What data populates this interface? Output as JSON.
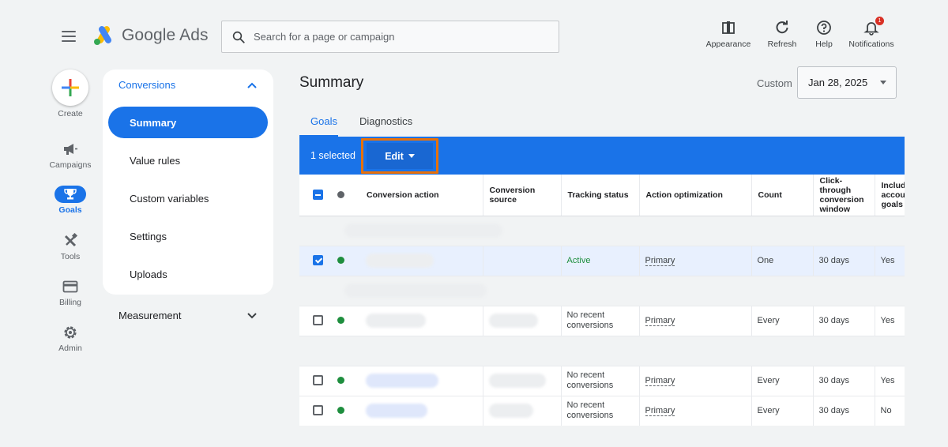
{
  "header": {
    "brand": "Google Ads",
    "search_placeholder": "Search for a page or campaign",
    "actions": [
      {
        "label": "Appearance",
        "icon": "appearance-icon"
      },
      {
        "label": "Refresh",
        "icon": "refresh-icon"
      },
      {
        "label": "Help",
        "icon": "help-icon"
      },
      {
        "label": "Notifications",
        "icon": "bell-icon",
        "badge": "1"
      }
    ]
  },
  "rail": {
    "create": "Create",
    "items": [
      {
        "label": "Campaigns",
        "icon": "megaphone-icon"
      },
      {
        "label": "Goals",
        "icon": "trophy-icon",
        "active": true
      },
      {
        "label": "Tools",
        "icon": "tools-icon"
      },
      {
        "label": "Billing",
        "icon": "credit-card-icon"
      },
      {
        "label": "Admin",
        "icon": "gear-icon"
      }
    ]
  },
  "subnav": {
    "section": "Conversions",
    "items": [
      {
        "label": "Summary",
        "active": true
      },
      {
        "label": "Value rules"
      },
      {
        "label": "Custom variables"
      },
      {
        "label": "Settings"
      },
      {
        "label": "Uploads"
      }
    ],
    "measurement": "Measurement"
  },
  "main": {
    "title": "Summary",
    "date_label": "Custom",
    "date_value": "Jan 28, 2025",
    "tabs": [
      "Goals",
      "Diagnostics"
    ],
    "selection_text": "1 selected",
    "edit_label": "Edit"
  },
  "table": {
    "columns": [
      "Conversion action",
      "Conversion source",
      "Tracking status",
      "Action optimization",
      "Count",
      "Click-through conversion window",
      "Include in account-level goals"
    ],
    "columns_display": [
      "Conversion action",
      "Conversion source",
      "Tracking status",
      "Action optimization",
      "Count",
      "Click-through conversion window",
      "Include accoun goals"
    ],
    "rows": [
      {
        "checked": true,
        "status": "Active",
        "optimization": "Primary",
        "count": "One",
        "window": "30 days",
        "include": "Yes"
      },
      {
        "checked": false,
        "status": "No recent conversions",
        "optimization": "Primary",
        "count": "Every",
        "window": "30 days",
        "include": "Yes"
      },
      {
        "checked": false,
        "status": "No recent conversions",
        "optimization": "Primary",
        "count": "Every",
        "window": "30 days",
        "include": "Yes"
      },
      {
        "checked": false,
        "status": "No recent conversions",
        "optimization": "Primary",
        "count": "Every",
        "window": "30 days",
        "include": "No"
      }
    ]
  },
  "colors": {
    "accent": "#1a73e8",
    "highlight": "#e8710a",
    "status_green": "#1e8e3e",
    "badge_red": "#d93025"
  }
}
